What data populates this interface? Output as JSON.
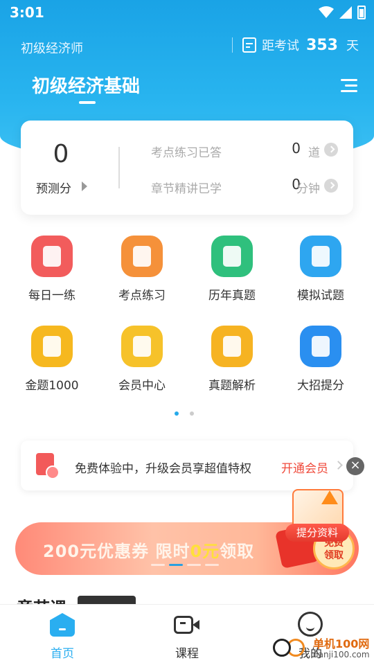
{
  "status_bar": {
    "time": "3:01"
  },
  "header": {
    "exam_level": "初级经济师",
    "countdown_label": "距考试",
    "countdown_days": "353",
    "countdown_unit": "天",
    "subject_title": "初级经济基础"
  },
  "stats": {
    "score": "0",
    "score_label": "预测分",
    "rows": [
      {
        "label": "考点练习已答",
        "value": "0",
        "unit": "道"
      },
      {
        "label": "章节精讲已学",
        "value": "0",
        "unit": "分钟"
      }
    ]
  },
  "grid": {
    "items": [
      {
        "label": "每日一练",
        "icon": "daily-practice-icon",
        "color": "#f25c5c"
      },
      {
        "label": "考点练习",
        "icon": "key-points-icon",
        "color": "#f5913a"
      },
      {
        "label": "历年真题",
        "icon": "past-papers-icon",
        "color": "#2fc07d"
      },
      {
        "label": "模拟试题",
        "icon": "mock-exam-icon",
        "color": "#2ea6f0"
      },
      {
        "label": "金题1000",
        "icon": "gold-questions-icon",
        "color": "#f6b81f"
      },
      {
        "label": "会员中心",
        "icon": "crown-icon",
        "color": "#f6c22a"
      },
      {
        "label": "真题解析",
        "icon": "analysis-icon",
        "color": "#f6b322"
      },
      {
        "label": "大招提分",
        "icon": "video-hot-icon",
        "color": "#2a8ff0"
      }
    ],
    "page_count": 2,
    "active_page": 0
  },
  "promo": {
    "text": "免费体验中，升级会员享超值特权",
    "cta": "开通会员",
    "close": "×"
  },
  "float_badge": {
    "label": "提分资料"
  },
  "banner": {
    "text_prefix": "200元优惠券  限时",
    "text_highlight": "0元",
    "text_suffix": "领取",
    "stamp_line1": "免费",
    "stamp_line2": "领取"
  },
  "section_peek": "章节课",
  "bottom_nav": {
    "items": [
      {
        "label": "首页",
        "active": true,
        "color": "#2aaef0"
      },
      {
        "label": "课程",
        "active": false,
        "color": "#333333"
      },
      {
        "label": "我的",
        "active": false,
        "color": "#333333"
      }
    ]
  },
  "watermark": {
    "main": "单机100网",
    "sub": "danji100.com"
  }
}
